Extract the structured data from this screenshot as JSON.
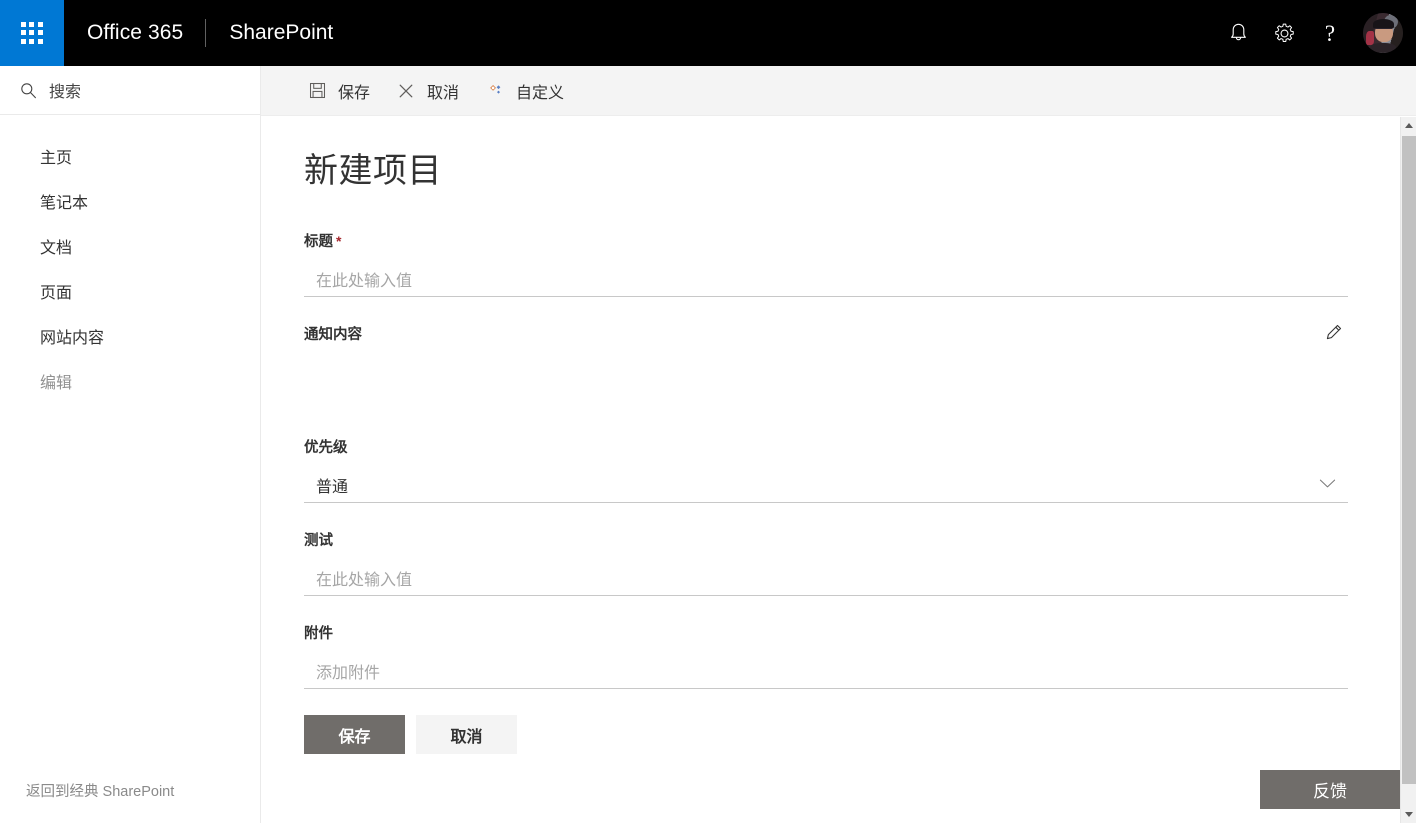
{
  "suite_header": {
    "waffle_tooltip": "应用启动器",
    "brand": "Office 365",
    "app_name": "SharePoint",
    "actions": {
      "notifications": "通知",
      "settings": "设置",
      "help": "?",
      "avatar": "用户头像"
    }
  },
  "left_nav": {
    "search": {
      "label": "搜索",
      "placeholder": "搜索"
    },
    "items": [
      {
        "label": "主页",
        "muted": false
      },
      {
        "label": "笔记本",
        "muted": false
      },
      {
        "label": "文档",
        "muted": false
      },
      {
        "label": "页面",
        "muted": false
      },
      {
        "label": "网站内容",
        "muted": false
      },
      {
        "label": "编辑",
        "muted": true
      }
    ],
    "classic_link": "返回到经典 SharePoint"
  },
  "command_bar": {
    "save": "保存",
    "cancel": "取消",
    "customize": "自定义"
  },
  "form": {
    "title": "新建项目",
    "fields": {
      "title_field": {
        "label": "标题",
        "required_mark": "*",
        "placeholder": "在此处输入值",
        "value": ""
      },
      "notice_field": {
        "label": "通知内容",
        "edit_icon": "pencil-icon",
        "value": ""
      },
      "priority_field": {
        "label": "优先级",
        "value": "普通",
        "options": [
          "普通"
        ]
      },
      "test_field": {
        "label": "测试",
        "placeholder": "在此处输入值",
        "value": ""
      },
      "attachment_field": {
        "label": "附件",
        "placeholder": "添加附件",
        "value": ""
      }
    },
    "actions": {
      "save": "保存",
      "cancel": "取消"
    }
  },
  "feedback": {
    "label": "反馈"
  },
  "colors": {
    "accent_blue": "#0078d4",
    "header_black": "#000000",
    "required_red": "#a4262c",
    "button_taupe": "#706d6a",
    "toolbar_gray": "#f4f4f4"
  }
}
